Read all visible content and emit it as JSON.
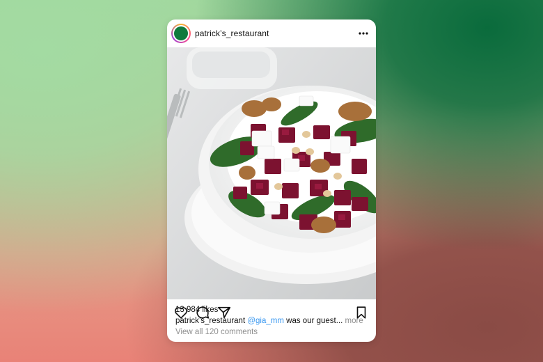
{
  "post": {
    "username": "patrick’s_restaurant",
    "menu_icon": "more-horizontal-icon",
    "avatar_color": "#0f7a3d",
    "likes": "13 984 likes",
    "caption": {
      "username": "patrick’s_restaurant",
      "mention": "@gia_mm",
      "text": "was our guest...",
      "more": "more"
    },
    "view_comments": "View all 120 comments",
    "actions": [
      "heart-icon",
      "comment-icon",
      "share-icon",
      "bookmark-icon"
    ]
  }
}
